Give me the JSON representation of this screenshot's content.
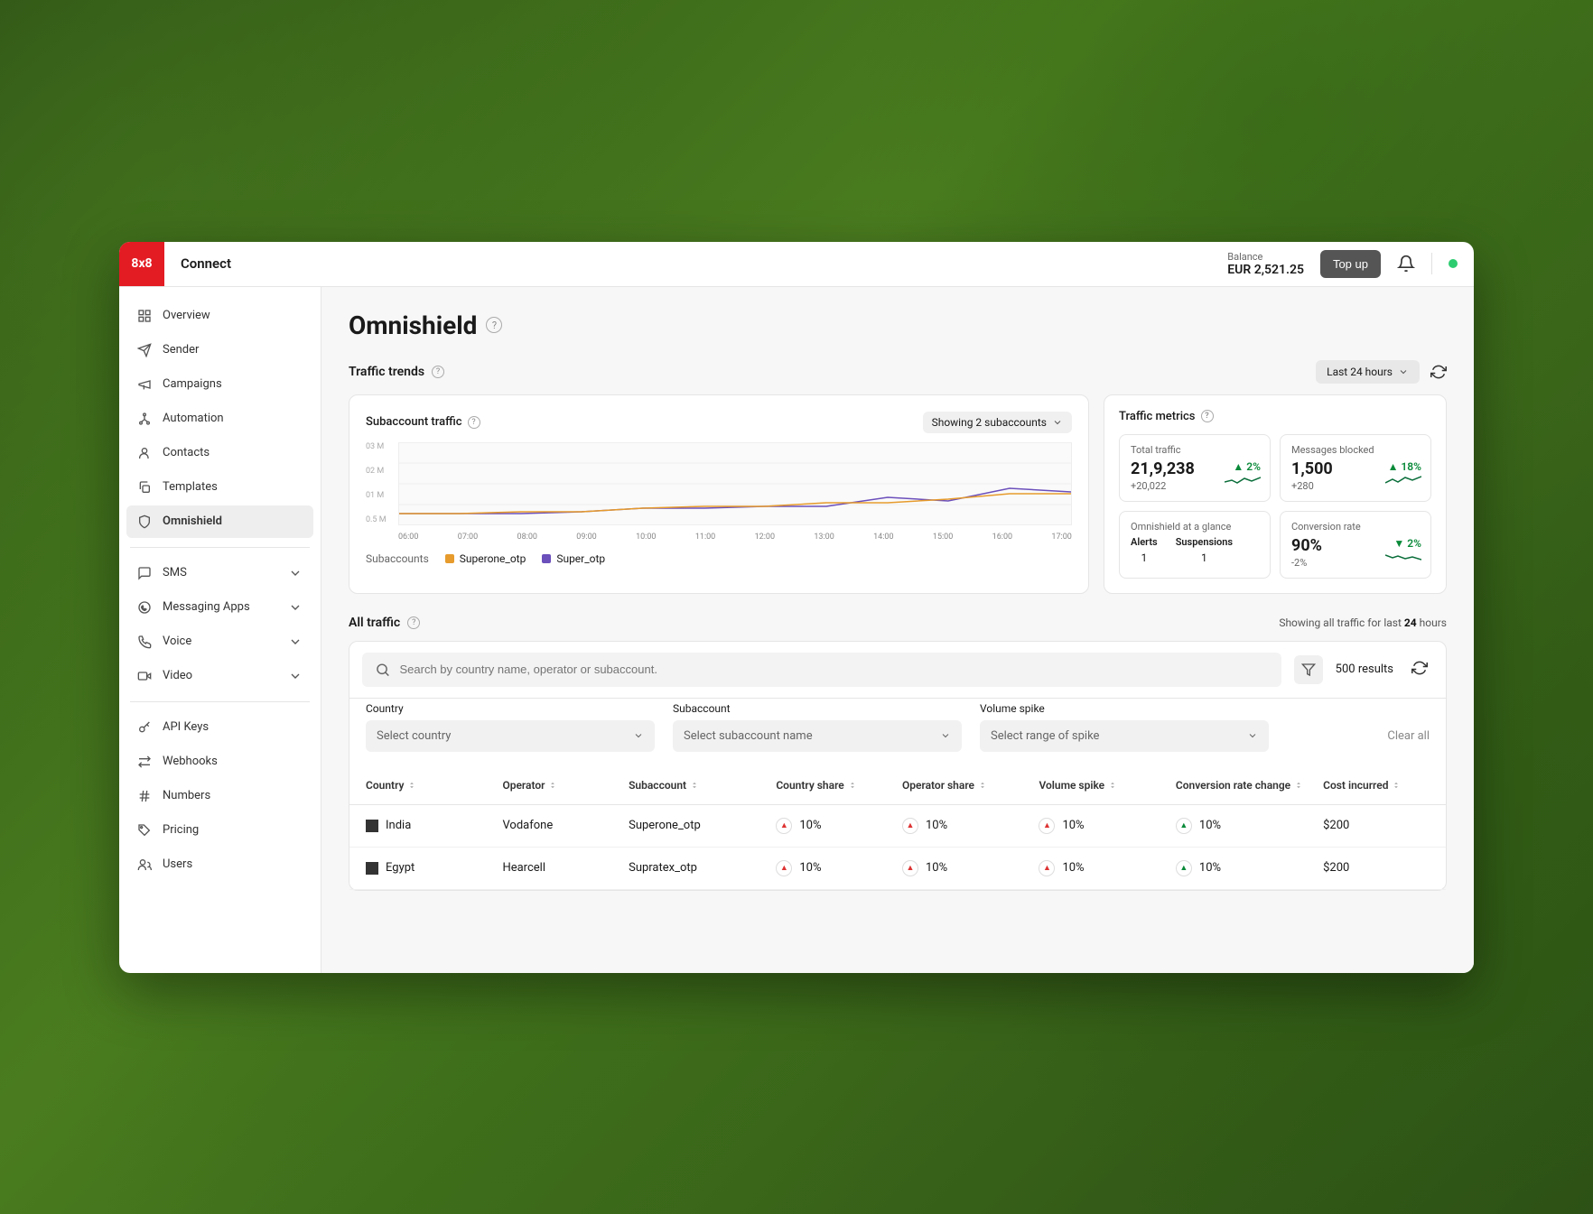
{
  "header": {
    "logo": "8x8",
    "app_name": "Connect",
    "balance_label": "Balance",
    "balance_value": "EUR 2,521.25",
    "topup_label": "Top up"
  },
  "sidebar": {
    "items": [
      {
        "label": "Overview",
        "icon": "grid"
      },
      {
        "label": "Sender",
        "icon": "send"
      },
      {
        "label": "Campaigns",
        "icon": "megaphone"
      },
      {
        "label": "Automation",
        "icon": "nodes"
      },
      {
        "label": "Contacts",
        "icon": "user"
      },
      {
        "label": "Templates",
        "icon": "copy"
      },
      {
        "label": "Omnishield",
        "icon": "shield",
        "active": true
      },
      {
        "label": "SMS",
        "icon": "chat",
        "chevron": true
      },
      {
        "label": "Messaging Apps",
        "icon": "whatsapp",
        "chevron": true
      },
      {
        "label": "Voice",
        "icon": "phone",
        "chevron": true
      },
      {
        "label": "Video",
        "icon": "video",
        "chevron": true
      }
    ],
    "items2": [
      {
        "label": "API Keys",
        "icon": "key"
      },
      {
        "label": "Webhooks",
        "icon": "arrows"
      },
      {
        "label": "Numbers",
        "icon": "hash"
      },
      {
        "label": "Pricing",
        "icon": "tag"
      },
      {
        "label": "Users",
        "icon": "users"
      }
    ]
  },
  "page": {
    "title": "Omnishield"
  },
  "trends": {
    "section_title": "Traffic trends",
    "range_label": "Last 24 hours",
    "chart": {
      "title": "Subaccount traffic",
      "showing_label": "Showing 2 subaccounts",
      "legend_label": "Subaccounts",
      "series1_name": "Superone_otp",
      "series1_color": "#e69b2c",
      "series2_name": "Super_otp",
      "series2_color": "#6b4fbb"
    },
    "metrics": {
      "title": "Traffic metrics",
      "total_traffic": {
        "label": "Total traffic",
        "value": "21,9,238",
        "delta": "+20,022",
        "pct": "2%",
        "dir": "up"
      },
      "blocked": {
        "label": "Messages blocked",
        "value": "1,500",
        "delta": "+280",
        "pct": "18%",
        "dir": "up"
      },
      "glance": {
        "label": "Omnishield at a glance",
        "alerts_label": "Alerts",
        "alerts": "1",
        "susp_label": "Suspensions",
        "susp": "1"
      },
      "conversion": {
        "label": "Conversion rate",
        "value": "90%",
        "delta": "-2%",
        "pct": "2%",
        "dir": "down"
      }
    }
  },
  "all_traffic": {
    "title": "All traffic",
    "summary_prefix": "Showing all traffic for last",
    "summary_hours": "24",
    "summary_suffix": "hours",
    "search_placeholder": "Search by country name, operator or subaccount.",
    "results_count": "500 results",
    "filters": {
      "country": {
        "label": "Country",
        "placeholder": "Select country"
      },
      "subaccount": {
        "label": "Subaccount",
        "placeholder": "Select subaccount name"
      },
      "volume": {
        "label": "Volume spike",
        "placeholder": "Select range of spike"
      },
      "clear": "Clear all"
    },
    "columns": [
      "Country",
      "Operator",
      "Subaccount",
      "Country share",
      "Operator share",
      "Volume spike",
      "Conversion rate change",
      "Cost incurred"
    ],
    "rows": [
      {
        "country": "India",
        "operator": "Vodafone",
        "subaccount": "Superone_otp",
        "country_share": "10%",
        "operator_share": "10%",
        "volume_spike": "10%",
        "conv": "10%",
        "cost": "$200",
        "conv_dir": "up-green"
      },
      {
        "country": "Egypt",
        "operator": "Hearcell",
        "subaccount": "Supratex_otp",
        "country_share": "10%",
        "operator_share": "10%",
        "volume_spike": "10%",
        "conv": "10%",
        "cost": "$200",
        "conv_dir": "up-green"
      }
    ]
  },
  "chart_data": {
    "type": "line",
    "title": "Subaccount traffic",
    "xlabel": "",
    "ylabel": "",
    "ylim": [
      0,
      0.03
    ],
    "y_ticks": [
      "03 M",
      "02 M",
      "01 M",
      "0.5 M"
    ],
    "categories": [
      "06:00",
      "07:00",
      "08:00",
      "09:00",
      "10:00",
      "11:00",
      "12:00",
      "13:00",
      "14:00",
      "15:00",
      "16:00",
      "17:00"
    ],
    "series": [
      {
        "name": "Superone_otp",
        "color": "#e69b2c",
        "values": [
          0.5,
          0.5,
          0.6,
          0.6,
          0.7,
          0.8,
          0.8,
          0.9,
          0.9,
          1.0,
          1.1,
          1.1
        ]
      },
      {
        "name": "Super_otp",
        "color": "#6b4fbb",
        "values": [
          0.5,
          0.5,
          0.5,
          0.6,
          0.7,
          0.7,
          0.8,
          0.8,
          1.0,
          0.9,
          1.2,
          1.1
        ]
      }
    ]
  }
}
